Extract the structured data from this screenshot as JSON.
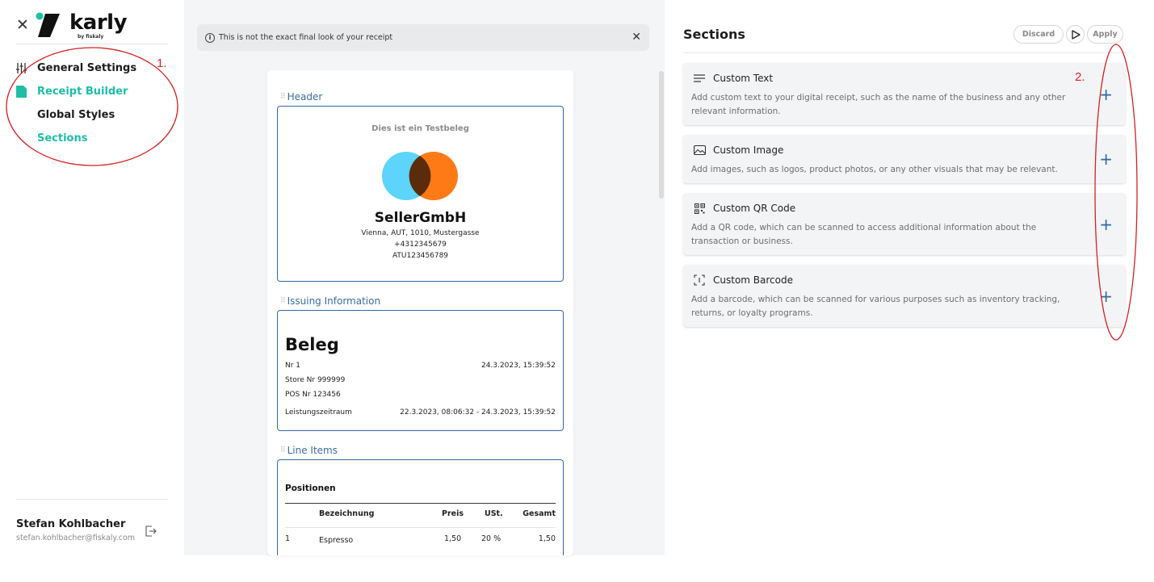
{
  "sidebar": {
    "brand": "karly",
    "brand_sub": "by fiskaly",
    "nav": [
      {
        "label": "General Settings"
      },
      {
        "label": "Receipt Builder"
      },
      {
        "label": "Global Styles"
      },
      {
        "label": "Sections"
      }
    ],
    "user": {
      "name": "Stefan Kohlbacher",
      "email": "stefan.kohlbacher@fiskaly.com"
    }
  },
  "preview": {
    "banner_text": "This is not the exact final look of your receipt",
    "header": {
      "title": "Header",
      "test_label": "Dies ist ein Testbeleg",
      "seller_name": "SellerGmbH",
      "address": "Vienna, AUT, 1010, Mustergasse",
      "phone": "+4312345679",
      "vat": "ATU123456789"
    },
    "issuing": {
      "title": "Issuing Information",
      "beleg": "Beleg",
      "nr_label": "Nr 1",
      "nr_date": "24.3.2023, 15:39:52",
      "store": "Store Nr  999999",
      "pos": "POS Nr  123456",
      "period_label": "Leistungszeitraum",
      "period_value": "22.3.2023, 08:06:32 - 24.3.2023, 15:39:52"
    },
    "line_items": {
      "title": "Line Items",
      "table_title": "Positionen",
      "columns": [
        "Bezeichnung",
        "Preis",
        "USt.",
        "Gesamt"
      ],
      "rows": [
        {
          "no": "1",
          "name": "Espresso",
          "price": "1,50",
          "vat": "20 %",
          "total": "1,50"
        }
      ]
    }
  },
  "sections": {
    "title": "Sections",
    "buttons": {
      "discard": "Discard",
      "apply": "Apply"
    },
    "cards": [
      {
        "title": "Custom Text",
        "icon": "text-lines-icon",
        "desc": "Add custom text to your digital receipt, such as the name of the business and any other relevant information."
      },
      {
        "title": "Custom Image",
        "icon": "image-icon",
        "desc": "Add images, such as logos, product photos, or any other visuals that may be relevant."
      },
      {
        "title": "Custom QR Code",
        "icon": "qr-code-icon",
        "desc": "Add a QR code, which can be scanned to access additional information about the transaction or business."
      },
      {
        "title": "Custom Barcode",
        "icon": "barcode-scan-icon",
        "desc": "Add a barcode, which can be scanned for various purposes such as inventory tracking, returns, or loyalty programs."
      }
    ],
    "plus": "+"
  },
  "annotations": {
    "one": "1.",
    "two": "2.",
    "color": "#d22222"
  },
  "colors": {
    "accent_green": "#1ebea5",
    "accent_blue": "#2f6aa5"
  }
}
